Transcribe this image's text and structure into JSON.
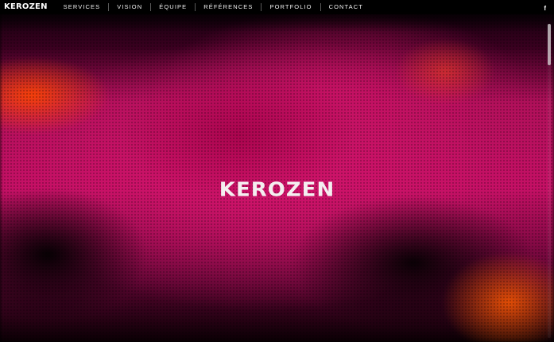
{
  "navbar": {
    "brand": "KEROZEN",
    "items": [
      {
        "label": "SERVICES"
      },
      {
        "label": "VISION"
      },
      {
        "label": "ÉQUIPE"
      },
      {
        "label": "RÉFÉRENCES"
      },
      {
        "label": "PORTFOLIO"
      },
      {
        "label": "CONTACT"
      }
    ],
    "social": {
      "facebook_label": "f",
      "icon": "facebook-icon"
    }
  },
  "hero": {
    "logo_text": "KEROZEN",
    "colors": {
      "primary": "#c51065",
      "accent": "#ff5a00",
      "background": "#000000"
    }
  }
}
